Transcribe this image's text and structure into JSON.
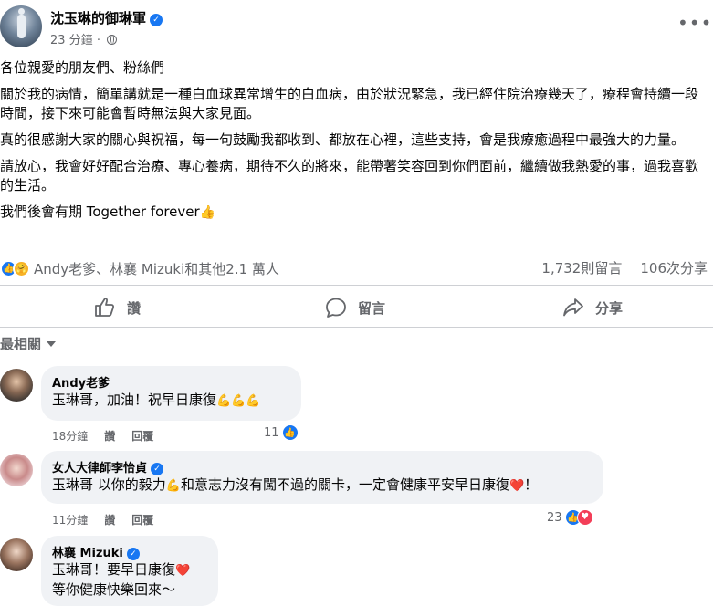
{
  "post": {
    "page_name": "沈玉琳的御琳軍",
    "time": "23 分鐘",
    "separator": "·",
    "more_label": "•••",
    "paragraphs": [
      "各位親愛的朋友們、粉絲們",
      "關於我的病情，簡單講就是一種白血球異常增生的白血病，由於狀況緊急，我已經住院治療幾天了，療程會持續一段時間，接下來可能會暫時無法與大家見面。",
      "真的很感謝大家的關心與祝福，每一句鼓勵我都收到、都放在心裡，這些支持，會是我療癒過程中最強大的力量。",
      "請放心，我會好好配合治療、專心養病，期待不久的將來，能帶著笑容回到你們面前，繼續做我熱愛的事，過我喜歡的生活。"
    ],
    "closing": "我們後會有期  Together forever",
    "closing_emoji": "👍",
    "reactors": "Andy老爹、林襄 Mizuki和其他2.1 萬人",
    "comment_count": "1,732則留言",
    "share_count": "106次分享"
  },
  "actions": {
    "like": "讚",
    "comment": "留言",
    "share": "分享"
  },
  "sort": {
    "label": "最相關"
  },
  "comments": [
    {
      "name": "Andy老爹",
      "text": "玉琳哥，加油！祝早日康復",
      "emoji": "💪💪💪",
      "time": "18分鐘",
      "like": "讚",
      "reply": "回覆",
      "reaction_count": "11"
    },
    {
      "name": "女人大律師李怡貞",
      "text_before": "玉琳哥 以你的毅力",
      "emoji_mid": "💪",
      "text_after": "和意志力沒有闖不過的關卡，一定會健康平安早日康復",
      "emoji_end": "❤️",
      "text_tail": "！",
      "time": "11分鐘",
      "like": "讚",
      "reply": "回覆",
      "reaction_count": "23"
    },
    {
      "name": "林襄 Mizuki",
      "line1": "玉琳哥！要早日康復",
      "line1_emoji": "❤️",
      "line2": "等你健康快樂回來～"
    }
  ],
  "colors": {
    "accent": "#1877f2",
    "text_secondary": "#65676b",
    "bubble": "#f0f2f5",
    "love": "#f33e58"
  },
  "icons": [
    "verified-badge-icon",
    "globe-icon",
    "more-icon",
    "like-icon",
    "comment-icon",
    "share-icon",
    "caret-down-icon"
  ]
}
